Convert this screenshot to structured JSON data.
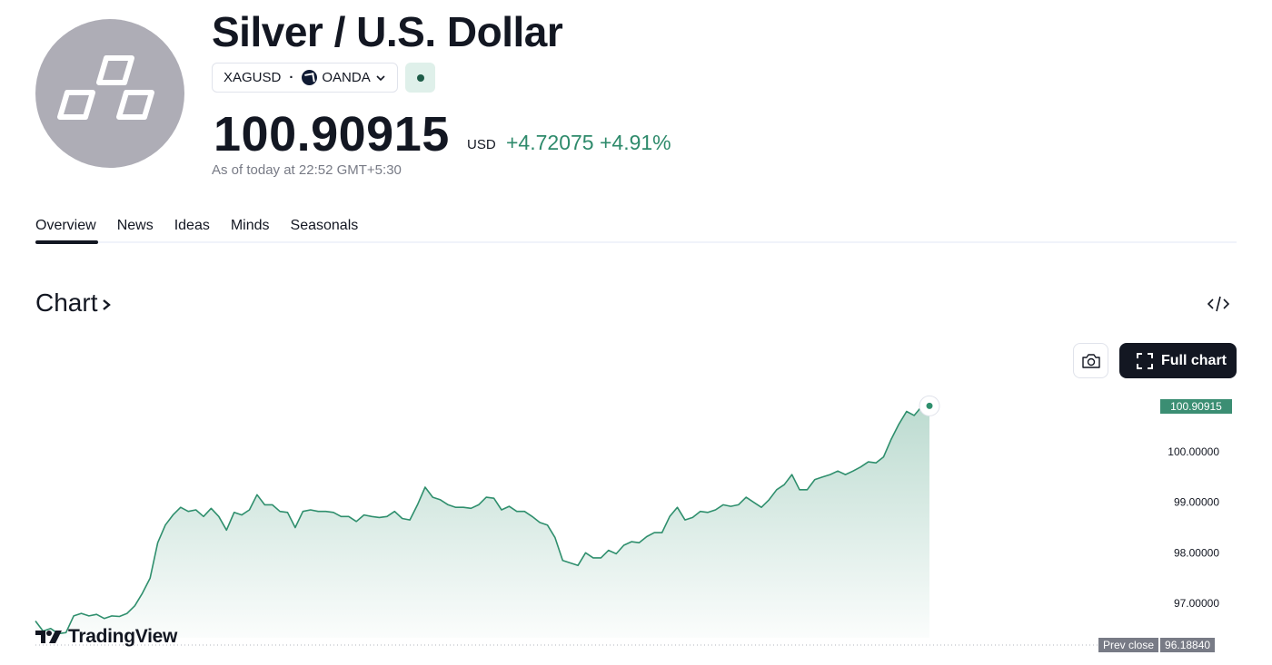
{
  "header": {
    "title": "Silver / U.S. Dollar",
    "symbol": "XAGUSD",
    "exchange": "OANDA",
    "price": "100.90915",
    "currency": "USD",
    "change_abs": "+4.72075",
    "change_pct": "+4.91%",
    "as_of": "As of today at 22:52 GMT+5:30"
  },
  "tabs": [
    "Overview",
    "News",
    "Ideas",
    "Minds",
    "Seasonals"
  ],
  "chart_section": {
    "heading": "Chart",
    "full_chart_label": "Full chart",
    "last_price_label": "100.90915",
    "prev_close_label": "Prev close",
    "prev_close_value": "96.18840",
    "brand": "TradingView"
  },
  "colors": {
    "accent_green": "#2e8a6b",
    "line_green": "#2f8f6d",
    "text": "#131722",
    "muted": "#787b86"
  },
  "icons": [
    "silver-bars-icon",
    "oanda-logo-icon",
    "chevron-down-icon",
    "live-status-icon",
    "chevron-right-icon",
    "embed-code-icon",
    "camera-icon",
    "fullscreen-icon",
    "tradingview-logo-icon"
  ],
  "chart_data": {
    "type": "area",
    "ylim": [
      96.2,
      101.4
    ],
    "yticks": [
      "100.00000",
      "99.00000",
      "98.00000",
      "97.00000"
    ],
    "ytick_values": [
      100.0,
      99.0,
      98.0,
      97.0
    ],
    "last_value": 100.90915,
    "prev_close": 96.1884,
    "series": [
      {
        "values": [
          96.65,
          96.45,
          96.5,
          96.4,
          96.42,
          96.75,
          96.8,
          96.75,
          96.78,
          96.7,
          96.75,
          96.74,
          96.8,
          96.95,
          97.2,
          97.5,
          98.2,
          98.55,
          98.75,
          98.9,
          98.82,
          98.85,
          98.72,
          98.88,
          98.72,
          98.45,
          98.8,
          98.75,
          98.85,
          99.15,
          98.95,
          98.95,
          98.82,
          98.8,
          98.5,
          98.82,
          98.85,
          98.82,
          98.82,
          98.8,
          98.72,
          98.72,
          98.62,
          98.75,
          98.72,
          98.7,
          98.72,
          98.82,
          98.68,
          98.65,
          98.95,
          99.3,
          99.1,
          99.05,
          98.95,
          98.9,
          98.9,
          98.88,
          98.95,
          99.1,
          99.08,
          98.85,
          98.92,
          98.82,
          98.82,
          98.72,
          98.6,
          98.55,
          98.3,
          97.85,
          97.8,
          97.75,
          98.0,
          97.9,
          97.9,
          98.05,
          97.98,
          98.15,
          98.22,
          98.2,
          98.32,
          98.4,
          98.4,
          98.72,
          98.9,
          98.65,
          98.7,
          98.82,
          98.8,
          98.85,
          98.95,
          98.92,
          98.95,
          99.1,
          99.0,
          98.9,
          99.05,
          99.25,
          99.35,
          99.55,
          99.25,
          99.25,
          99.45,
          99.5,
          99.55,
          99.62,
          99.55,
          99.62,
          99.7,
          99.8,
          99.78,
          99.9,
          100.25,
          100.55,
          100.8,
          100.72,
          100.9,
          100.91
        ]
      }
    ]
  }
}
